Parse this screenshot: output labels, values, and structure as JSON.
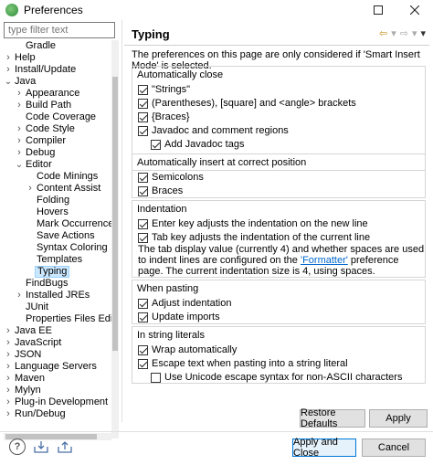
{
  "window": {
    "title": "Preferences"
  },
  "filter": {
    "placeholder": "type filter text"
  },
  "tree": [
    {
      "label": "Gradle",
      "level": 1,
      "arrow": ""
    },
    {
      "label": "Help",
      "level": 0,
      "arrow": "right"
    },
    {
      "label": "Install/Update",
      "level": 0,
      "arrow": "right"
    },
    {
      "label": "Java",
      "level": 0,
      "arrow": "down"
    },
    {
      "label": "Appearance",
      "level": 1,
      "arrow": "right"
    },
    {
      "label": "Build Path",
      "level": 1,
      "arrow": "right"
    },
    {
      "label": "Code Coverage",
      "level": 1,
      "arrow": ""
    },
    {
      "label": "Code Style",
      "level": 1,
      "arrow": "right"
    },
    {
      "label": "Compiler",
      "level": 1,
      "arrow": "right"
    },
    {
      "label": "Debug",
      "level": 1,
      "arrow": "right"
    },
    {
      "label": "Editor",
      "level": 1,
      "arrow": "down"
    },
    {
      "label": "Code Minings",
      "level": 2,
      "arrow": ""
    },
    {
      "label": "Content Assist",
      "level": 2,
      "arrow": "right"
    },
    {
      "label": "Folding",
      "level": 2,
      "arrow": ""
    },
    {
      "label": "Hovers",
      "level": 2,
      "arrow": ""
    },
    {
      "label": "Mark Occurrences",
      "level": 2,
      "arrow": ""
    },
    {
      "label": "Save Actions",
      "level": 2,
      "arrow": ""
    },
    {
      "label": "Syntax Coloring",
      "level": 2,
      "arrow": ""
    },
    {
      "label": "Templates",
      "level": 2,
      "arrow": ""
    },
    {
      "label": "Typing",
      "level": 2,
      "arrow": "",
      "selected": true
    },
    {
      "label": "FindBugs",
      "level": 1,
      "arrow": ""
    },
    {
      "label": "Installed JREs",
      "level": 1,
      "arrow": "right"
    },
    {
      "label": "JUnit",
      "level": 1,
      "arrow": ""
    },
    {
      "label": "Properties Files Editor",
      "level": 1,
      "arrow": ""
    },
    {
      "label": "Java EE",
      "level": 0,
      "arrow": "right"
    },
    {
      "label": "JavaScript",
      "level": 0,
      "arrow": "right"
    },
    {
      "label": "JSON",
      "level": 0,
      "arrow": "right"
    },
    {
      "label": "Language Servers",
      "level": 0,
      "arrow": "right"
    },
    {
      "label": "Maven",
      "level": 0,
      "arrow": "right"
    },
    {
      "label": "Mylyn",
      "level": 0,
      "arrow": "right"
    },
    {
      "label": "Plug-in Development",
      "level": 0,
      "arrow": "right"
    },
    {
      "label": "Run/Debug",
      "level": 0,
      "arrow": "right"
    }
  ],
  "page": {
    "title": "Typing",
    "description": "The preferences on this page are only considered if 'Smart Insert Mode' is selected."
  },
  "groups": {
    "auto_close": {
      "title": "Automatically close",
      "items": [
        {
          "label": "\"Strings\"",
          "checked": true,
          "indent": 0
        },
        {
          "label": "(Parentheses), [square] and <angle> brackets",
          "checked": true,
          "indent": 0
        },
        {
          "label": "{Braces}",
          "checked": true,
          "indent": 0
        },
        {
          "label": "Javadoc and comment regions",
          "checked": true,
          "indent": 0
        },
        {
          "label": "Add Javadoc tags",
          "checked": true,
          "indent": 1
        }
      ]
    },
    "auto_insert": {
      "title": "Automatically insert at correct position",
      "items": [
        {
          "label": "Semicolons",
          "checked": true,
          "indent": 0
        },
        {
          "label": "Braces",
          "checked": true,
          "indent": 0
        }
      ]
    },
    "indentation": {
      "title": "Indentation",
      "items": [
        {
          "label": "Enter key adjusts the indentation on the new line",
          "checked": true,
          "indent": 0
        },
        {
          "label": "Tab key adjusts the indentation of the current line",
          "checked": true,
          "indent": 0
        }
      ],
      "info_before": "The tab display value (currently 4) and whether spaces are used to indent lines are configured on the ",
      "info_link": "'Formatter'",
      "info_after": " preference page. The current indentation size is 4, using spaces."
    },
    "pasting": {
      "title": "When pasting",
      "items": [
        {
          "label": "Adjust indentation",
          "checked": true,
          "indent": 0
        },
        {
          "label": "Update imports",
          "checked": true,
          "indent": 0
        }
      ]
    },
    "string_literals": {
      "title": "In string literals",
      "items": [
        {
          "label": "Wrap automatically",
          "checked": true,
          "indent": 0
        },
        {
          "label": "Escape text when pasting into a string literal",
          "checked": true,
          "indent": 0
        },
        {
          "label": "Use Unicode escape syntax for non-ASCII characters",
          "checked": false,
          "indent": 1
        }
      ]
    }
  },
  "buttons": {
    "restore_defaults": "Restore Defaults",
    "apply": "Apply",
    "apply_and_close": "Apply and Close",
    "cancel": "Cancel"
  },
  "icons": {
    "help": "?",
    "import": "import-icon",
    "export": "export-icon"
  }
}
